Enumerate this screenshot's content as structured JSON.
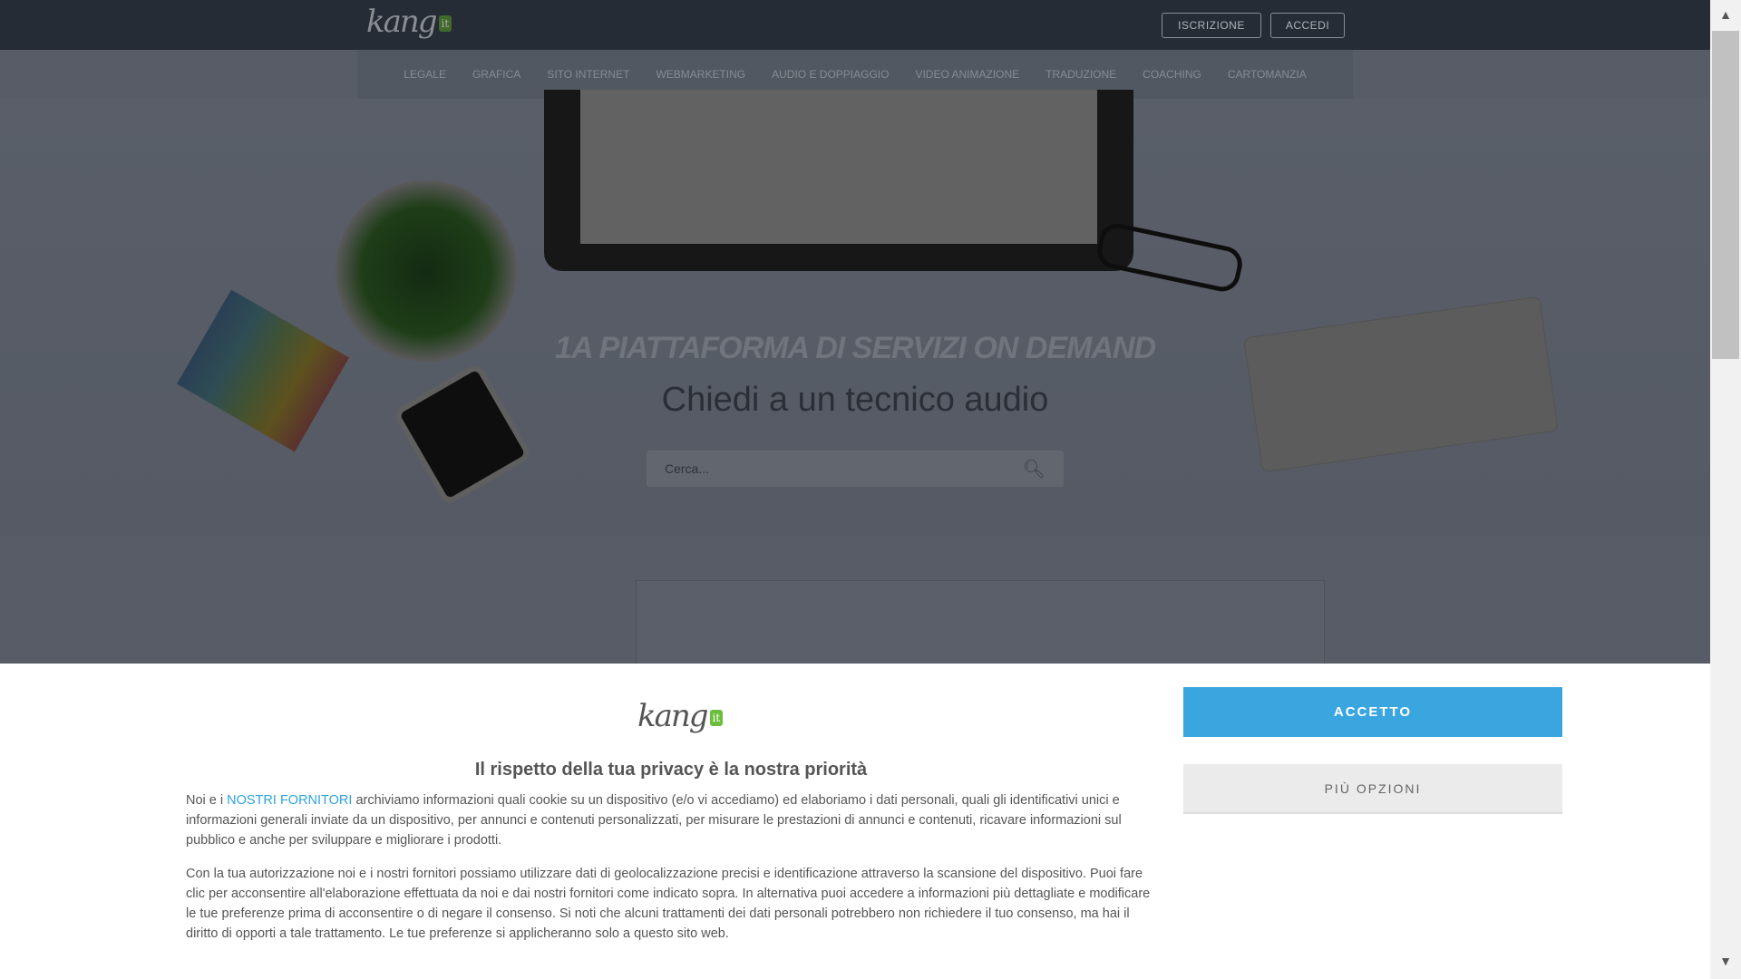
{
  "header": {
    "logo": "kang",
    "logo_badge": "it",
    "signup": "ISCRIZIONE",
    "login": "ACCEDI"
  },
  "nav": [
    "LEGALE",
    "GRAFICA",
    "SITO INTERNET",
    "WEBMARKETING",
    "AUDIO E DOPPIAGGIO",
    "VIDEO ANIMAZIONE",
    "TRADUZIONE",
    "COACHING",
    "CARTOMANZIA"
  ],
  "hero": {
    "tagline": "1A PIATTAFORMA DI SERVIZI ON DEMAND",
    "subtitle": "Chiedi a un tecnico audio",
    "search_placeholder": "Cerca..."
  },
  "banner": {
    "logo": "kang",
    "logo_badge": "it",
    "title": "Il rispetto della tua privacy è la nostra priorità",
    "p1_pre": "Noi e i ",
    "p1_link": "NOSTRI FORNITORI",
    "p1_post": " archiviamo informazioni quali cookie su un dispositivo (e/o vi accediamo) ed elaboriamo i dati personali, quali gli identificativi unici e informazioni generali inviate da un dispositivo, per annunci e contenuti personalizzati, per misurare le prestazioni di annunci e contenuti, ricavare informazioni sul pubblico e anche per sviluppare e migliorare i prodotti.",
    "p2": "Con la tua autorizzazione noi e i nostri fornitori possiamo utilizzare dati di geolocalizzazione precisi e identificazione attraverso la scansione del dispositivo. Puoi fare clic per acconsentire all'elaborazione effettuata da noi e dai nostri fornitori come indicato sopra. In alternativa puoi accedere a informazioni più dettagliate e modificare le tue preferenze prima di acconsentire o di negare il consenso. Si noti che alcuni trattamenti dei dati personali potrebbero non richiedere il tuo consenso, ma hai il diritto di opporti a tale trattamento. Le tue preferenze si applicheranno solo a questo sito web.",
    "accept": "ACCETTO",
    "more": "PIÙ OPZIONI"
  },
  "colors": {
    "accent": "#3aa6e0",
    "brand_green": "#6cbf3c",
    "topbar": "#2a2f3a"
  }
}
